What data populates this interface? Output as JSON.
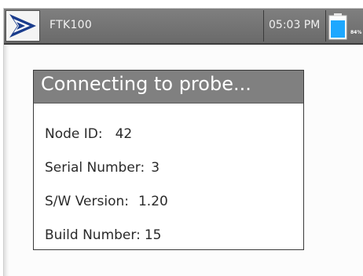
{
  "status_bar": {
    "device_name": "FTK100",
    "time": "05:03 PM",
    "battery_percent": "84%",
    "battery_level": 0.84,
    "logo_icon": "arrow-chevron-logo",
    "battery_icon": "battery-icon",
    "colors": {
      "bar_background": "#747474",
      "logo_blue": "#1a3c8c",
      "battery_fill": "#1ea8ff"
    }
  },
  "dialog": {
    "title": "Connecting to probe...",
    "header_color": "#808080",
    "rows": [
      {
        "label": "Node ID:",
        "value": "42"
      },
      {
        "label": "Serial Number:",
        "value": "3"
      },
      {
        "label": "S/W Version:",
        "value": "1.20"
      },
      {
        "label": "Build Number:",
        "value": "15"
      }
    ]
  }
}
